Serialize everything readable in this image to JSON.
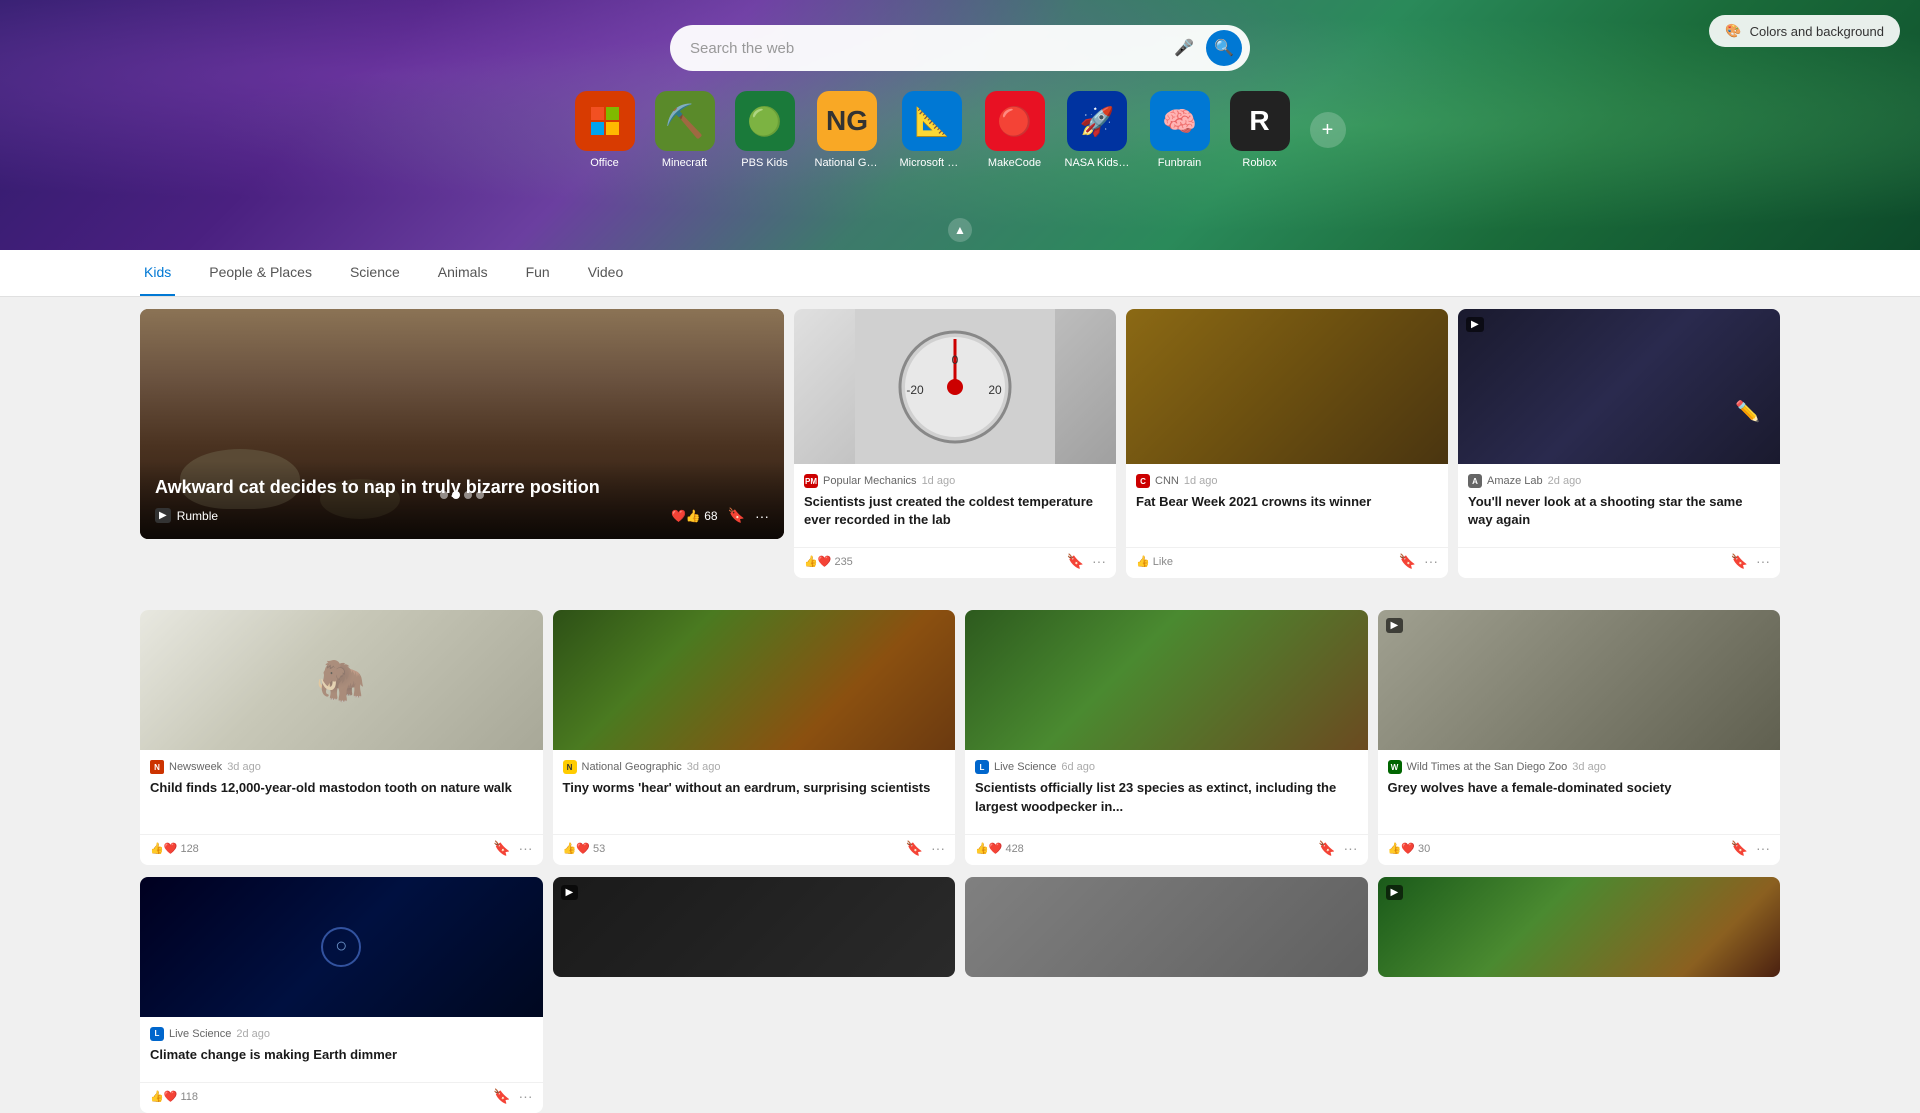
{
  "hero": {
    "search_placeholder": "Search the web",
    "colors_btn_label": "Colors and background"
  },
  "apps": [
    {
      "id": "office",
      "label": "Office",
      "emoji": "🔴",
      "bg": "#d83b01"
    },
    {
      "id": "minecraft",
      "label": "Minecraft",
      "emoji": "🟩",
      "bg": "#5a8a2a"
    },
    {
      "id": "pbs-kids",
      "label": "PBS Kids",
      "emoji": "🟢",
      "bg": "#2e7d32"
    },
    {
      "id": "national-geo",
      "label": "National Geo...",
      "emoji": "🟡",
      "bg": "#f9a825"
    },
    {
      "id": "microsoft-math",
      "label": "Microsoft Ma...",
      "emoji": "🔵",
      "bg": "#0078d4"
    },
    {
      "id": "makecode",
      "label": "MakeCode",
      "emoji": "🔴",
      "bg": "#e81123"
    },
    {
      "id": "nasa-kids",
      "label": "NASA Kids Club",
      "emoji": "🔵",
      "bg": "#0033a0"
    },
    {
      "id": "funbrain",
      "label": "Funbrain",
      "emoji": "🔵",
      "bg": "#0078d4"
    },
    {
      "id": "roblox",
      "label": "Roblox",
      "emoji": "🔴",
      "bg": "#e50000"
    }
  ],
  "nav": {
    "tabs": [
      {
        "id": "kids",
        "label": "Kids",
        "active": true
      },
      {
        "id": "people-places",
        "label": "People & Places",
        "active": false
      },
      {
        "id": "science",
        "label": "Science",
        "active": false
      },
      {
        "id": "animals",
        "label": "Animals",
        "active": false
      },
      {
        "id": "fun",
        "label": "Fun",
        "active": false
      },
      {
        "id": "video",
        "label": "Video",
        "active": false
      }
    ]
  },
  "featured": {
    "title": "Awkward cat decides to nap in truly bizarre position",
    "source": "Rumble",
    "reactions": "❤️👍 68"
  },
  "cards": [
    {
      "id": "popular-mechanics",
      "source_name": "Popular Mechanics",
      "source_time": "1d ago",
      "source_class": "source-pm",
      "source_text": "PM",
      "title": "Scientists just created the coldest temperature ever recorded in the lab",
      "reactions": "👍❤️ 235",
      "thumb_class": "thumb-thermometer"
    },
    {
      "id": "cnn-fat-bear",
      "source_name": "CNN",
      "source_time": "1d ago",
      "source_class": "source-cnn",
      "source_text": "C",
      "title": "Fat Bear Week 2021 crowns its winner",
      "reactions": "👍 Like",
      "thumb_class": "thumb-bear"
    },
    {
      "id": "amaze-lab",
      "source_name": "Amaze Lab",
      "source_time": "2d ago",
      "source_class": "source-amaze",
      "source_text": "A",
      "title": "You'll never look at a shooting star the same way again",
      "reactions": "",
      "thumb_class": "thumb-meteor",
      "is_video": true
    },
    {
      "id": "newsweek-mastodon",
      "source_name": "Newsweek",
      "source_time": "3d ago",
      "source_class": "source-newsweek",
      "source_text": "N",
      "title": "Child finds 12,000-year-old mastodon tooth on nature walk",
      "reactions": "👍❤️ 128",
      "thumb_class": "thumb-mammoth"
    },
    {
      "id": "natgeo-worms",
      "source_name": "National Geographic",
      "source_time": "3d ago",
      "source_class": "source-natgeo",
      "source_text": "N",
      "title": "Tiny worms 'hear' without an eardrum, surprising scientists",
      "reactions": "👍❤️ 53",
      "thumb_class": "thumb-worm"
    },
    {
      "id": "livesci-woodpecker",
      "source_name": "Live Science",
      "source_time": "6d ago",
      "source_class": "source-livesci",
      "source_text": "L",
      "title": "Scientists officially list 23 species as extinct, including the largest woodpecker in...",
      "reactions": "👍❤️ 428",
      "thumb_class": "thumb-woodpecker"
    },
    {
      "id": "wildtimes-wolves",
      "source_name": "Wild Times at the San Diego Zoo",
      "source_time": "3d ago",
      "source_class": "source-wildtimes",
      "source_text": "W",
      "title": "Grey wolves have a female-dominated society",
      "reactions": "👍❤️ 30",
      "thumb_class": "thumb-wolf",
      "is_video": true
    },
    {
      "id": "livesci-climate",
      "source_name": "Live Science",
      "source_time": "2d ago",
      "source_class": "source-livesci",
      "source_text": "L",
      "title": "Climate change is making Earth dimmer",
      "reactions": "👍❤️ 118",
      "thumb_class": "thumb-dark"
    }
  ],
  "bottom_cards": [
    {
      "id": "b1",
      "thumb_class": "thumb-bottom1",
      "is_video": true
    },
    {
      "id": "b2",
      "thumb_class": "thumb-bottom2"
    },
    {
      "id": "b3",
      "thumb_class": "thumb-parrot",
      "is_video": true
    },
    {
      "id": "b4",
      "thumb_class": "thumb-bottom4"
    }
  ]
}
